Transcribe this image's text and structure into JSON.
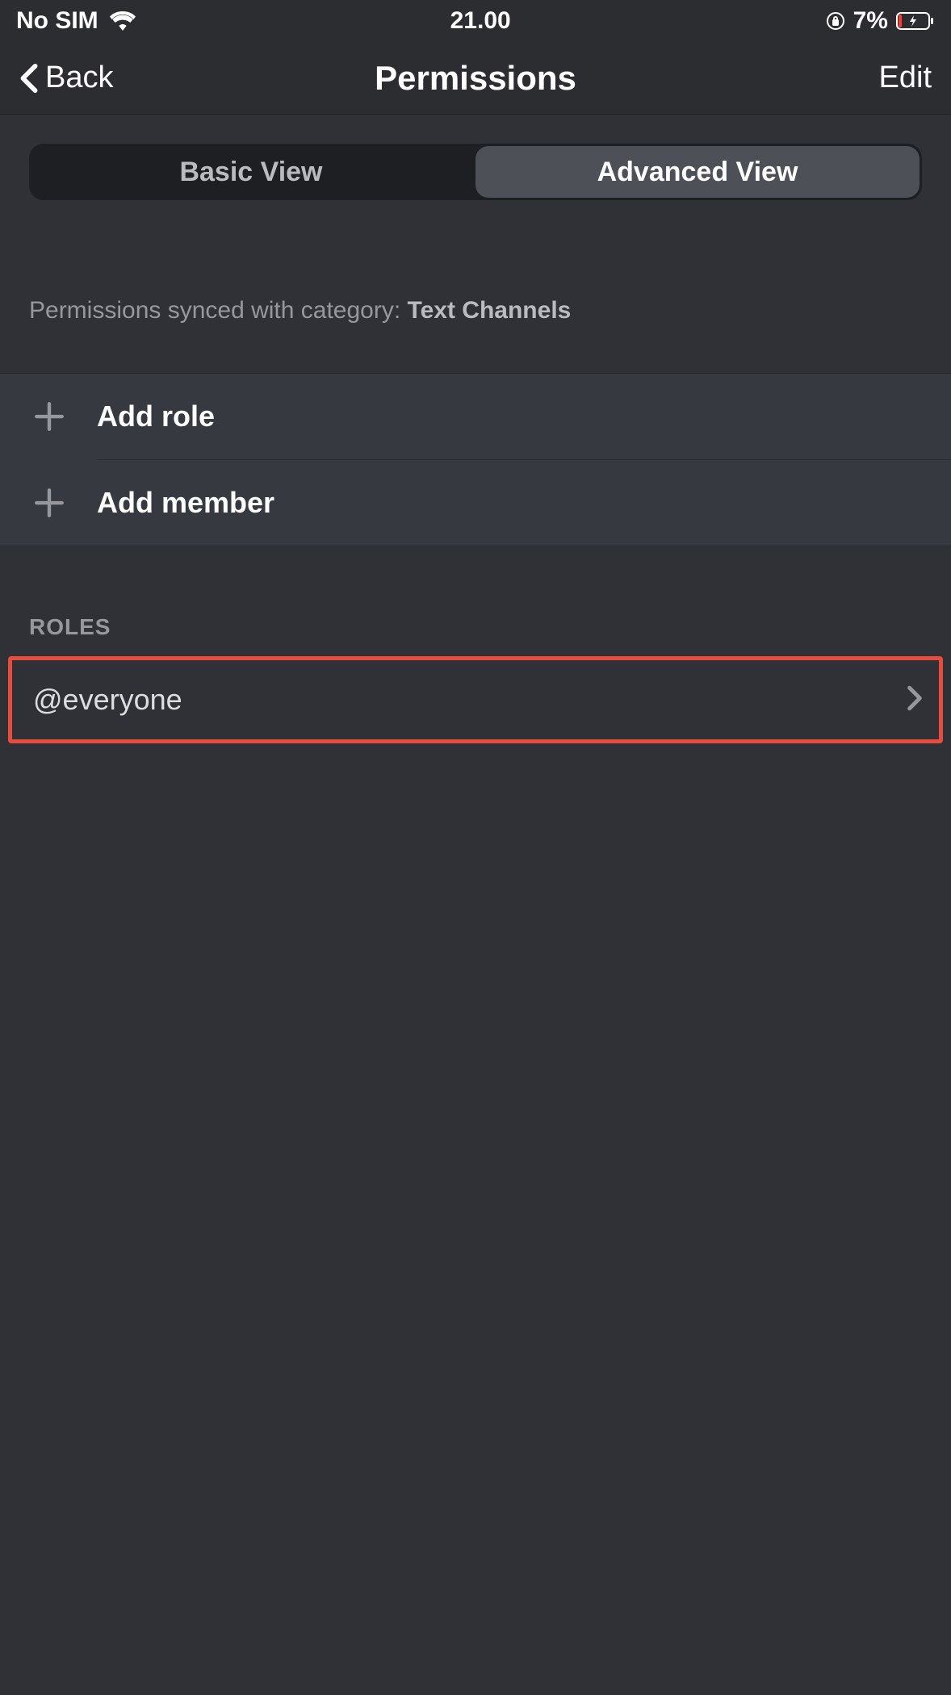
{
  "status": {
    "sim": "No SIM",
    "time": "21.00",
    "battery_pct": "7%"
  },
  "nav": {
    "back": "Back",
    "title": "Permissions",
    "edit": "Edit"
  },
  "tabs": {
    "basic": "Basic View",
    "advanced": "Advanced View"
  },
  "sync": {
    "prefix": "Permissions synced with category: ",
    "category": "Text Channels"
  },
  "actions": {
    "add_role": "Add role",
    "add_member": "Add member"
  },
  "roles": {
    "header": "ROLES",
    "items": [
      {
        "label": "@everyone"
      }
    ]
  }
}
